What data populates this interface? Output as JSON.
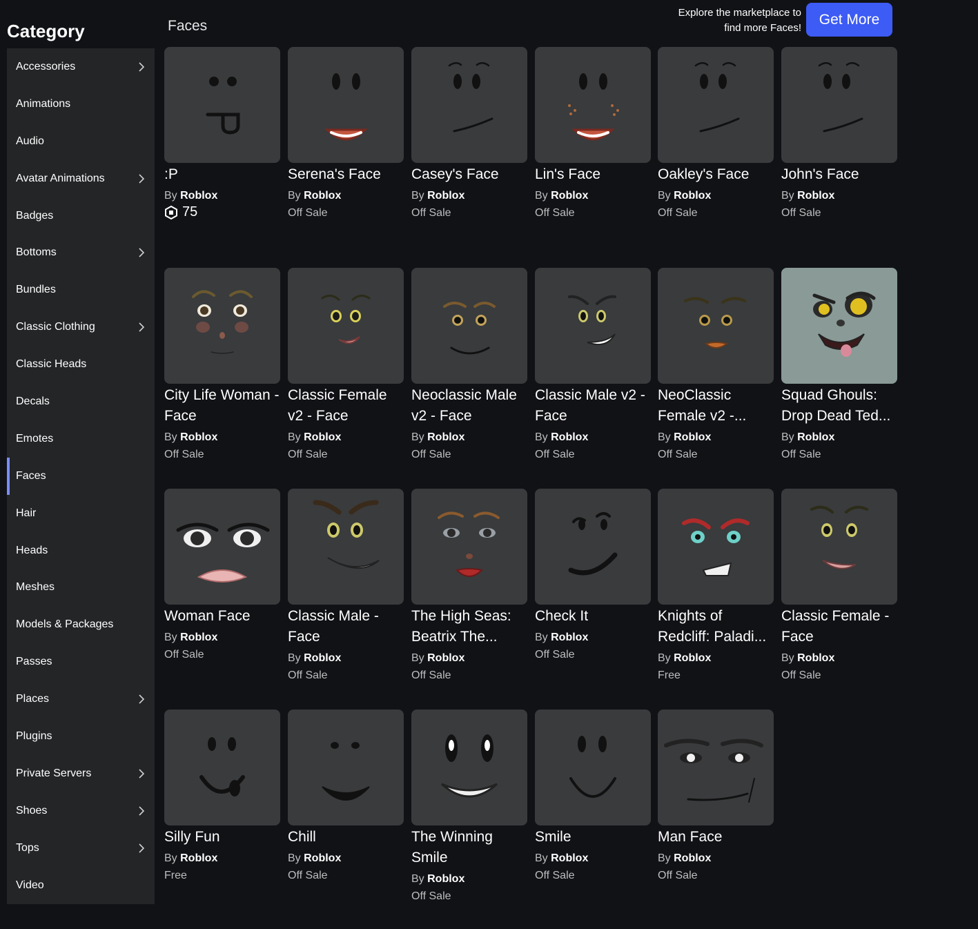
{
  "category_title": "Category",
  "section_title": "Faces",
  "promo": {
    "line1": "Explore the marketplace to",
    "line2": "find more Faces!",
    "button": "Get More"
  },
  "sidebar": [
    {
      "label": "Accessories",
      "chevron": true
    },
    {
      "label": "Animations",
      "chevron": false
    },
    {
      "label": "Audio",
      "chevron": false
    },
    {
      "label": "Avatar Animations",
      "chevron": true
    },
    {
      "label": "Badges",
      "chevron": false
    },
    {
      "label": "Bottoms",
      "chevron": true
    },
    {
      "label": "Bundles",
      "chevron": false
    },
    {
      "label": "Classic Clothing",
      "chevron": true
    },
    {
      "label": "Classic Heads",
      "chevron": false
    },
    {
      "label": "Decals",
      "chevron": false
    },
    {
      "label": "Emotes",
      "chevron": false
    },
    {
      "label": "Faces",
      "chevron": false,
      "active": true
    },
    {
      "label": "Hair",
      "chevron": false
    },
    {
      "label": "Heads",
      "chevron": false
    },
    {
      "label": "Meshes",
      "chevron": false
    },
    {
      "label": "Models & Packages",
      "chevron": false
    },
    {
      "label": "Passes",
      "chevron": false
    },
    {
      "label": "Places",
      "chevron": true
    },
    {
      "label": "Plugins",
      "chevron": false
    },
    {
      "label": "Private Servers",
      "chevron": true
    },
    {
      "label": "Shoes",
      "chevron": true
    },
    {
      "label": "Tops",
      "chevron": true
    },
    {
      "label": "Video",
      "chevron": false
    }
  ],
  "items": [
    {
      "name": ":P",
      "by": "By",
      "creator": "Roblox",
      "price": "75",
      "robux": true
    },
    {
      "name": "Serena's Face",
      "by": "By",
      "creator": "Roblox",
      "price": "Off Sale"
    },
    {
      "name": "Casey's Face",
      "by": "By",
      "creator": "Roblox",
      "price": "Off Sale"
    },
    {
      "name": "Lin's Face",
      "by": "By",
      "creator": "Roblox",
      "price": "Off Sale"
    },
    {
      "name": "Oakley's Face",
      "by": "By",
      "creator": "Roblox",
      "price": "Off Sale"
    },
    {
      "name": "John's Face",
      "by": "By",
      "creator": "Roblox",
      "price": "Off Sale"
    },
    {
      "name": "City Life Woman - Face",
      "by": "By",
      "creator": "Roblox",
      "price": "Off Sale"
    },
    {
      "name": "Classic Female v2 - Face",
      "by": "By",
      "creator": "Roblox",
      "price": "Off Sale"
    },
    {
      "name": "Neoclassic Male v2 - Face",
      "by": "By",
      "creator": "Roblox",
      "price": "Off Sale"
    },
    {
      "name": "Classic Male v2 - Face",
      "by": "By",
      "creator": "Roblox",
      "price": "Off Sale"
    },
    {
      "name": "NeoClassic Female v2 -...",
      "by": "By",
      "creator": "Roblox",
      "price": "Off Sale"
    },
    {
      "name": "Squad Ghouls: Drop Dead Ted...",
      "by": "By",
      "creator": "Roblox",
      "price": "Off Sale"
    },
    {
      "name": "Woman Face",
      "by": "By",
      "creator": "Roblox",
      "price": "Off Sale"
    },
    {
      "name": "Classic Male - Face",
      "by": "By",
      "creator": "Roblox",
      "price": "Off Sale"
    },
    {
      "name": "The High Seas: Beatrix The...",
      "by": "By",
      "creator": "Roblox",
      "price": "Off Sale"
    },
    {
      "name": "Check It",
      "by": "By",
      "creator": "Roblox",
      "price": "Off Sale"
    },
    {
      "name": "Knights of Redcliff: Paladi...",
      "by": "By",
      "creator": "Roblox",
      "price": "Free"
    },
    {
      "name": "Classic Female - Face",
      "by": "By",
      "creator": "Roblox",
      "price": "Off Sale"
    },
    {
      "name": "Silly Fun",
      "by": "By",
      "creator": "Roblox",
      "price": "Free"
    },
    {
      "name": "Chill",
      "by": "By",
      "creator": "Roblox",
      "price": "Off Sale"
    },
    {
      "name": "The Winning Smile",
      "by": "By",
      "creator": "Roblox",
      "price": "Off Sale"
    },
    {
      "name": "Smile",
      "by": "By",
      "creator": "Roblox",
      "price": "Off Sale"
    },
    {
      "name": "Man Face",
      "by": "By",
      "creator": "Roblox",
      "price": "Off Sale"
    }
  ]
}
